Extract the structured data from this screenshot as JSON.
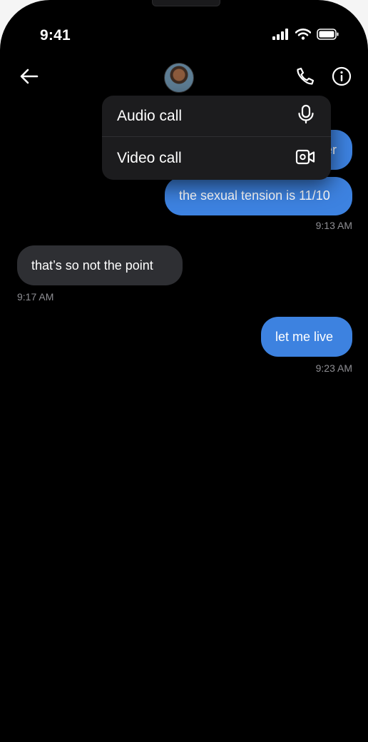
{
  "status_bar": {
    "time": "9:41",
    "icons": [
      "cellular-signal-icon",
      "wifi-icon",
      "battery-icon"
    ]
  },
  "header": {
    "back_icon": "arrow-left-icon",
    "avatar": "contact-avatar",
    "call_icon": "phone-icon",
    "info_icon": "info-icon"
  },
  "call_menu": {
    "items": [
      {
        "label": "Audio call",
        "icon": "microphone-icon"
      },
      {
        "label": "Video call",
        "icon": "video-camera-icon"
      }
    ]
  },
  "messages": [
    {
      "direction": "outgoing",
      "text": "er",
      "timestamp": ""
    },
    {
      "direction": "outgoing",
      "text": "the sexual tension is 11/10",
      "timestamp": "9:13 AM"
    },
    {
      "direction": "incoming",
      "text": "that’s so not the point",
      "timestamp": "9:17 AM"
    },
    {
      "direction": "outgoing",
      "text": "let me live",
      "timestamp": "9:23 AM"
    }
  ],
  "colors": {
    "background": "#000000",
    "outgoing_bubble": "#3d82e0",
    "incoming_bubble": "#2e2f33",
    "menu_background": "#1c1c1e",
    "timestamp": "#8e8e93"
  }
}
